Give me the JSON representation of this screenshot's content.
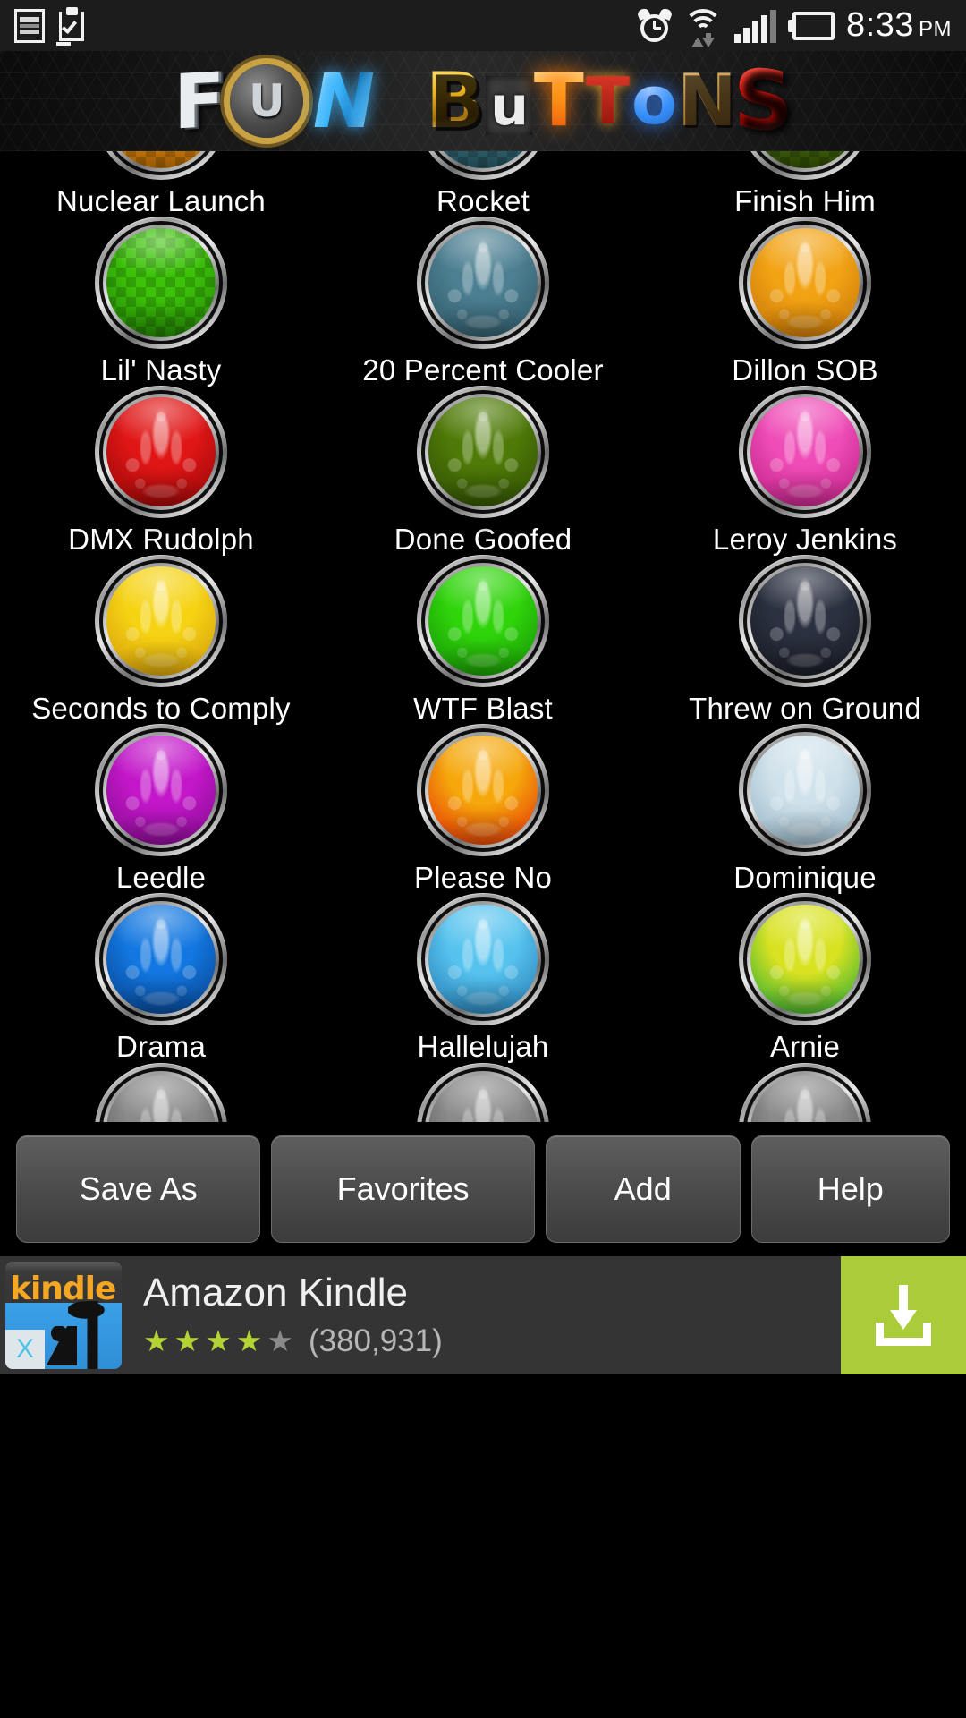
{
  "status_bar": {
    "time": "8:33",
    "am_pm": "PM",
    "icons": [
      "gallery-icon",
      "clipboard-check-icon",
      "alarm-clock-icon",
      "wifi-icon",
      "signal-bars-icon",
      "battery-icon"
    ],
    "signal_bars_active": 4,
    "signal_bars_total": 5,
    "battery_level": "full"
  },
  "header": {
    "app_title": "Fun Buttons",
    "logo_letters": [
      {
        "char": "F",
        "style": "silver-metal"
      },
      {
        "char": "U",
        "style": "gold-medallion"
      },
      {
        "char": "N",
        "style": "blue-chrome"
      },
      {
        "char": "B",
        "style": "gold"
      },
      {
        "char": "u",
        "style": "white-grunge"
      },
      {
        "char": "T",
        "style": "orange-glow"
      },
      {
        "char": "T",
        "style": "marquee-lights"
      },
      {
        "char": "o",
        "style": "blue-neon"
      },
      {
        "char": "N",
        "style": "wood"
      },
      {
        "char": "S",
        "style": "glossy-red"
      }
    ]
  },
  "grid": {
    "buttons": [
      {
        "label": "Nuclear Launch",
        "color": "#f0960c",
        "color2": "#b96a05",
        "pattern": "checker"
      },
      {
        "label": "Rocket",
        "color": "#3e7d8c",
        "color2": "#23505c",
        "pattern": "checker"
      },
      {
        "label": "Finish Him",
        "color": "#4f7a0a",
        "color2": "#2d4805",
        "pattern": "checker"
      },
      {
        "label": "Lil' Nasty",
        "color": "#3cc309",
        "color2": "#1f7a04",
        "pattern": "checker"
      },
      {
        "label": "20 Percent Cooler",
        "color": "#4c7f91",
        "color2": "#2b5361",
        "pattern": "damask"
      },
      {
        "label": "Dillon SOB",
        "color": "#f2a314",
        "color2": "#c06f05",
        "pattern": "damask"
      },
      {
        "label": "DMX Rudolph",
        "color": "#e01616",
        "color2": "#8d0505",
        "pattern": "damask"
      },
      {
        "label": "Done Goofed",
        "color": "#4e7a07",
        "color2": "#2c4804",
        "pattern": "damask"
      },
      {
        "label": "Leroy Jenkins",
        "color": "#ef4cb7",
        "color2": "#b81a7d",
        "pattern": "damask"
      },
      {
        "label": "Seconds to Comply",
        "color": "#f5d313",
        "color2": "#d1950a",
        "pattern": "damask"
      },
      {
        "label": "WTF Blast",
        "color": "#2fd40a",
        "color2": "#148a04",
        "pattern": "damask"
      },
      {
        "label": "Threw on Ground",
        "color": "#2b3140",
        "color2": "#14171f",
        "pattern": "damask"
      },
      {
        "label": "Leedle",
        "color": "#c317c9",
        "color2": "#7c0a86",
        "pattern": "damask"
      },
      {
        "label": "Please No",
        "color": "#f5a70b",
        "color2": "#e32306",
        "pattern": "damask"
      },
      {
        "label": "Dominique",
        "color": "#cfe1ea",
        "color2": "#8fb0c2",
        "pattern": "damask"
      },
      {
        "label": "Drama",
        "color": "#1277e0",
        "color2": "#063c84",
        "pattern": "damask"
      },
      {
        "label": "Hallelujah",
        "color": "#56c3ee",
        "color2": "#2173ad",
        "pattern": "damask"
      },
      {
        "label": "Arnie",
        "color": "#d9e220",
        "color2": "#14a63a",
        "pattern": "damask"
      },
      {
        "label": "",
        "color": "#8a8a8a",
        "color2": "#555555",
        "pattern": "damask"
      },
      {
        "label": "",
        "color": "#8a8a8a",
        "color2": "#555555",
        "pattern": "damask"
      },
      {
        "label": "",
        "color": "#8a8a8a",
        "color2": "#555555",
        "pattern": "damask"
      }
    ]
  },
  "toolbar": {
    "save_as": "Save As",
    "favorites": "Favorites",
    "add": "Add",
    "help": "Help"
  },
  "ad": {
    "icon_word": "kindle",
    "title": "Amazon Kindle",
    "rating": 4,
    "rating_max": 5,
    "review_count": "(380,931)",
    "cta_icon": "download-icon",
    "close_label": "X"
  }
}
